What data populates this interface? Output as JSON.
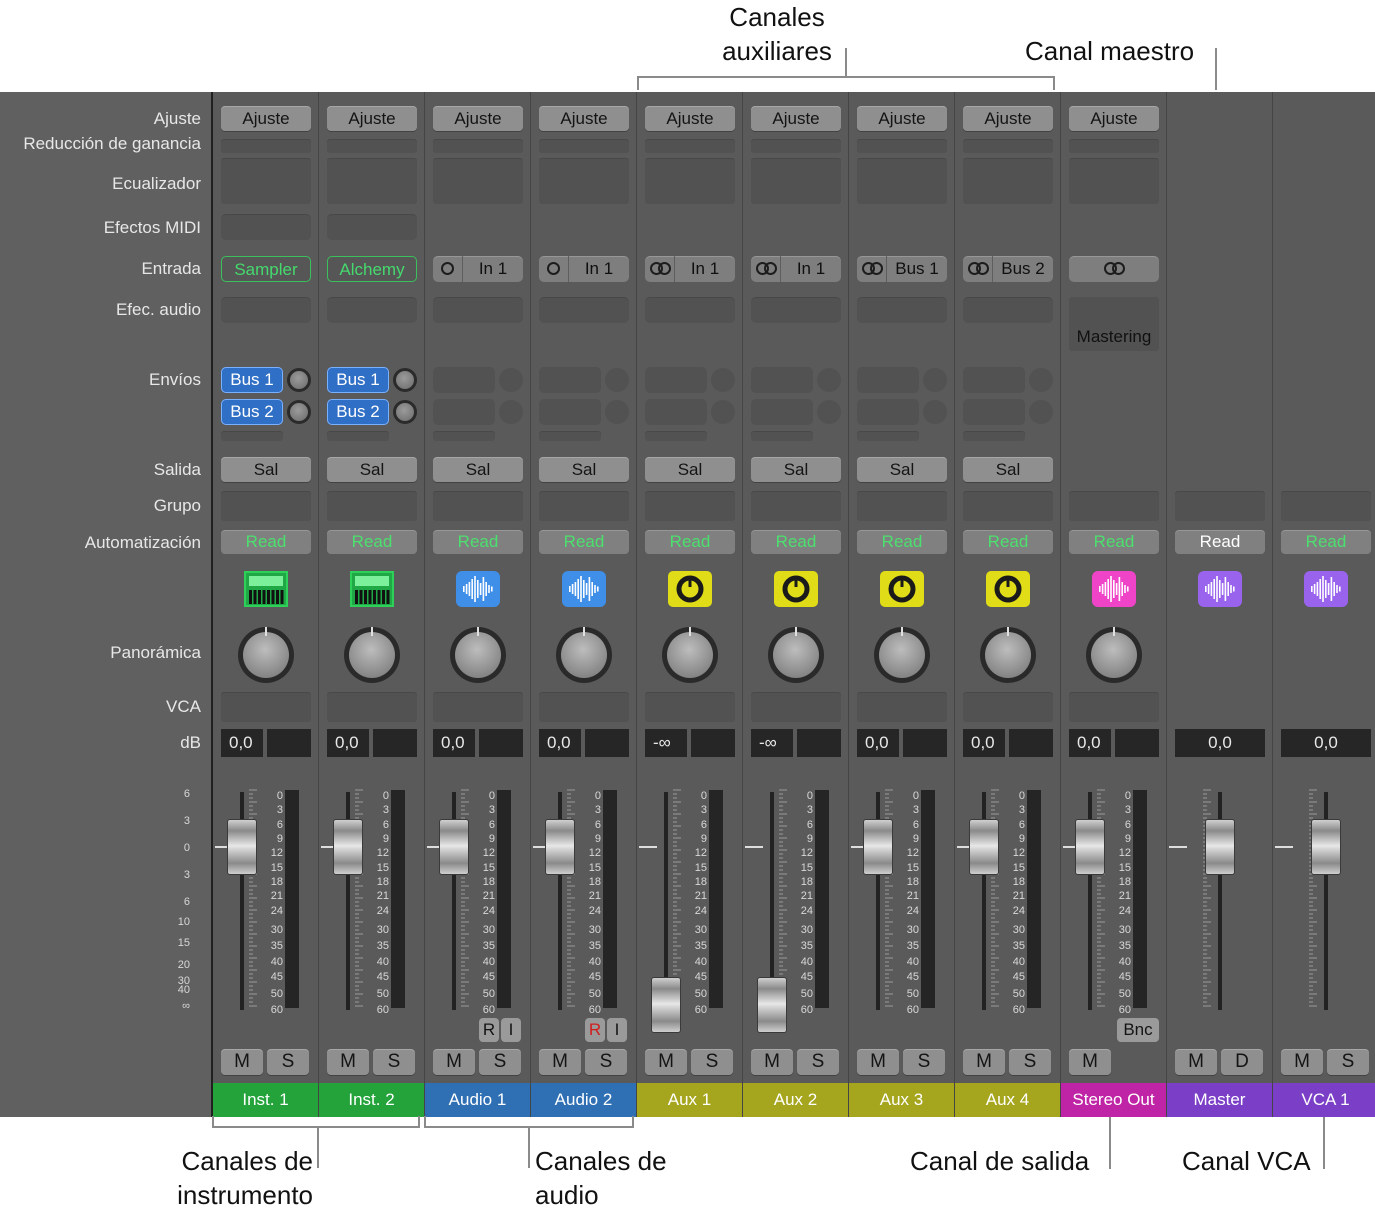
{
  "callouts": {
    "aux": "Canales\nauxiliares",
    "master": "Canal maestro",
    "instrument": "Canales de\ninstrumento",
    "audio": "Canales de\naudio",
    "output": "Canal de salida",
    "vca": "Canal VCA"
  },
  "rows": {
    "setting": "Ajuste",
    "gain": "Reducción de ganancia",
    "eq": "Ecualizador",
    "midi": "Efectos MIDI",
    "input": "Entrada",
    "audiofx": "Efec. audio",
    "sends": "Envíos",
    "output": "Salida",
    "group": "Grupo",
    "automation": "Automatización",
    "pan": "Panorámica",
    "vca": "VCA",
    "db": "dB"
  },
  "colors": {
    "instrument": "#23a33a",
    "audio": "#2f6fb3",
    "aux": "#a6a51e",
    "output": "#c024a6",
    "master": "#7a3fc6",
    "vca": "#7a3fc6"
  },
  "scale_labels": {
    "ticks": [
      "0",
      "3",
      "6",
      "9",
      "12",
      "15",
      "18",
      "21",
      "24",
      "30",
      "35",
      "40",
      "45",
      "50",
      "60"
    ],
    "left": [
      "6",
      "3",
      "0",
      "3",
      "6",
      "10",
      "15",
      "20",
      "30",
      "40",
      "∞"
    ]
  },
  "strips": [
    {
      "type": "instrument",
      "setting": "Ajuste",
      "input": "Sampler",
      "input_kind": "plugin",
      "send1": "Bus 1",
      "send2": "Bus 2",
      "output": "Sal",
      "automation": "Read",
      "icon": "instrument-sampler-icon",
      "db": "0,0",
      "fader": 0,
      "meter_scale": true,
      "ri": "",
      "m": "M",
      "s": "S",
      "name": "Inst. 1",
      "color": "instrument"
    },
    {
      "type": "instrument",
      "setting": "Ajuste",
      "input": "Alchemy",
      "input_kind": "plugin",
      "send1": "Bus 1",
      "send2": "Bus 2",
      "output": "Sal",
      "automation": "Read",
      "icon": "keyboard-icon",
      "db": "0,0",
      "fader": 0,
      "m": "M",
      "s": "S",
      "name": "Inst. 2",
      "color": "instrument"
    },
    {
      "type": "audio",
      "setting": "Ajuste",
      "input": "In 1",
      "input_kind": "mono",
      "output": "Sal",
      "automation": "Read",
      "icon": "waveform-icon",
      "db": "0,0",
      "fader": 0,
      "ri_r": "R",
      "ri_i": "I",
      "ri_red": false,
      "m": "M",
      "s": "S",
      "name": "Audio 1",
      "color": "audio"
    },
    {
      "type": "audio",
      "setting": "Ajuste",
      "input": "In 1",
      "input_kind": "mono",
      "output": "Sal",
      "automation": "Read",
      "icon": "waveform-icon",
      "db": "0,0",
      "fader": 0,
      "ri_r": "R",
      "ri_i": "I",
      "ri_red": true,
      "m": "M",
      "s": "S",
      "name": "Audio 2",
      "color": "audio"
    },
    {
      "type": "aux",
      "setting": "Ajuste",
      "input": "In 1",
      "input_kind": "stereo",
      "output": "Sal",
      "automation": "Read",
      "icon": "aux-knob-icon",
      "db": "-∞",
      "fader": 1,
      "m": "M",
      "s": "S",
      "name": "Aux 1",
      "color": "aux"
    },
    {
      "type": "aux",
      "setting": "Ajuste",
      "input": "In 1",
      "input_kind": "stereo",
      "output": "Sal",
      "automation": "Read",
      "icon": "aux-knob-icon",
      "db": "-∞",
      "fader": 1,
      "m": "M",
      "s": "S",
      "name": "Aux 2",
      "color": "aux"
    },
    {
      "type": "aux",
      "setting": "Ajuste",
      "input": "Bus 1",
      "input_kind": "stereo",
      "output": "Sal",
      "automation": "Read",
      "icon": "aux-knob-icon",
      "db": "0,0",
      "fader": 0,
      "m": "M",
      "s": "S",
      "name": "Aux 3",
      "color": "aux"
    },
    {
      "type": "aux",
      "setting": "Ajuste",
      "input": "Bus 2",
      "input_kind": "stereo",
      "output": "Sal",
      "automation": "Read",
      "icon": "aux-knob-icon",
      "db": "0,0",
      "fader": 0,
      "m": "M",
      "s": "S",
      "name": "Aux 4",
      "color": "aux"
    },
    {
      "type": "output",
      "setting": "Ajuste",
      "input": "",
      "input_kind": "stereo-only",
      "fx": "Mastering",
      "automation": "Read",
      "icon": "waveform-pink-icon",
      "db": "0,0",
      "fader": 0,
      "bnc": "Bnc",
      "m": "M",
      "name": "Stereo Out",
      "color": "output"
    },
    {
      "type": "master",
      "automation": "Read",
      "automation_white": true,
      "icon": "waveform-purple-icon",
      "db": "0,0",
      "fader": 0,
      "m": "M",
      "d": "D",
      "name": "Master",
      "color": "master"
    },
    {
      "type": "vca",
      "automation": "Read",
      "icon": "waveform-purple-icon",
      "db": "0,0",
      "fader": 0,
      "m": "M",
      "s": "S",
      "name": "VCA 1",
      "color": "vca"
    }
  ]
}
